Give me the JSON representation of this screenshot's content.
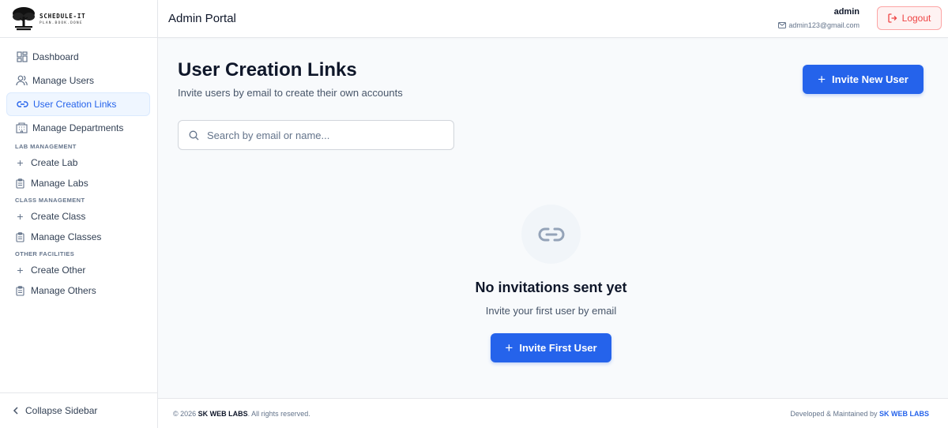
{
  "brand": {
    "name": "SCHEDULE-IT",
    "tagline": "PLAN.BOOK.DONE"
  },
  "sidebar": {
    "items": [
      {
        "label": "Dashboard",
        "icon": "dashboard-icon"
      },
      {
        "label": "Manage Users",
        "icon": "users-icon"
      },
      {
        "label": "User Creation Links",
        "icon": "link-icon",
        "active": true
      },
      {
        "label": "Manage Departments",
        "icon": "building-icon"
      }
    ],
    "sections": [
      {
        "title": "LAB MANAGEMENT",
        "items": [
          {
            "label": "Create Lab",
            "icon": "plus-icon"
          },
          {
            "label": "Manage Labs",
            "icon": "clipboard-icon"
          }
        ]
      },
      {
        "title": "CLASS MANAGEMENT",
        "items": [
          {
            "label": "Create Class",
            "icon": "plus-icon"
          },
          {
            "label": "Manage Classes",
            "icon": "clipboard-icon"
          }
        ]
      },
      {
        "title": "OTHER FACILITIES",
        "items": [
          {
            "label": "Create Other",
            "icon": "plus-icon"
          },
          {
            "label": "Manage Others",
            "icon": "clipboard-icon"
          }
        ]
      }
    ],
    "collapse_label": "Collapse Sidebar"
  },
  "header": {
    "title": "Admin Portal",
    "user_name": "admin",
    "user_email": "admin123@gmail.com",
    "logout_label": "Logout"
  },
  "main": {
    "title": "User Creation Links",
    "subtitle": "Invite users by email to create their own accounts",
    "invite_button": "Invite New User",
    "search_placeholder": "Search by email or name...",
    "empty_title": "No invitations sent yet",
    "empty_subtitle": "Invite your first user by email",
    "empty_button": "Invite First User"
  },
  "footer": {
    "copyright_prefix": "© 2026",
    "company": "SK WEB LABS",
    "rights": ". All rights reserved.",
    "credit_prefix": "Developed & Maintained by",
    "credit_company": "SK WEB LABS"
  },
  "colors": {
    "accent": "#2563eb",
    "danger": "#ef4444",
    "active_bg": "#eff6ff"
  }
}
